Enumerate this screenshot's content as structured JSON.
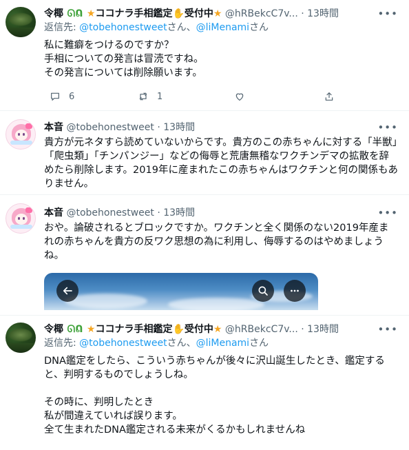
{
  "tweets": [
    {
      "display_name": "令椰",
      "name_badge": "ᘏᕠ",
      "name_suffix": "ココナラ手相鑑定",
      "name_suffix2": "受付中",
      "handle": "@hRBekcC7v...",
      "dot": "·",
      "time": "13時間",
      "reply_prefix": "返信先: ",
      "reply_mention1": "@tobehonestweet",
      "reply_mid": "さん、",
      "reply_mention2": "@liMenami",
      "reply_suffix": "さん",
      "text": "私に難癖をつけるのですか？\n手相についての発言は冒涜ですね。\nその発言については削除願います。",
      "reply_count": "6",
      "retweet_count": "1"
    },
    {
      "display_name": "本音",
      "handle": "@tobehonestweet",
      "dot": "·",
      "time": "13時間",
      "text": "貴方が元ネタすら読めていないからです。貴方のこの赤ちゃんに対する「半獣」「爬虫類」「チンパンジー」などの侮辱と荒唐無稽なワクチンデマの拡散を辞めたら削除します。2019年に産まれたこの赤ちゃんはワクチンと何の関係もありません。"
    },
    {
      "display_name": "本音",
      "handle": "@tobehonestweet",
      "dot": "·",
      "time": "13時間",
      "text": "おや。論破されるとブロックですか。ワクチンと全く関係のない2019年産まれの赤ちゃんを貴方の反ワク思想の為に利用し、侮辱するのはやめましょうね。"
    },
    {
      "display_name": "令椰",
      "name_badge": "ᘏᕠ",
      "name_suffix": "ココナラ手相鑑定",
      "name_suffix2": "受付中",
      "handle": "@hRBekcC7v...",
      "dot": "·",
      "time": "13時間",
      "reply_prefix": "返信先: ",
      "reply_mention1": "@tobehonestweet",
      "reply_mid": "さん、",
      "reply_mention2": "@liMenami",
      "reply_suffix": "さん",
      "text": "DNA鑑定をしたら、こういう赤ちゃんが後々に沢山誕生したとき、鑑定すると、判明するものでしょうしね。\n\nその時に、判明したとき\n私が間違えていれば誤ります。\n全て生まれたDNA鑑定される未来がくるかもしれませんね"
    }
  ],
  "icons": {
    "more": "more-icon",
    "reply": "reply-icon",
    "retweet": "retweet-icon",
    "like": "heart-icon",
    "share": "share-icon",
    "back": "back-arrow-icon",
    "search": "search-icon"
  },
  "colors": {
    "link": "#1d9bf0",
    "secondary_text": "#536471",
    "primary_text": "#0f1419"
  }
}
